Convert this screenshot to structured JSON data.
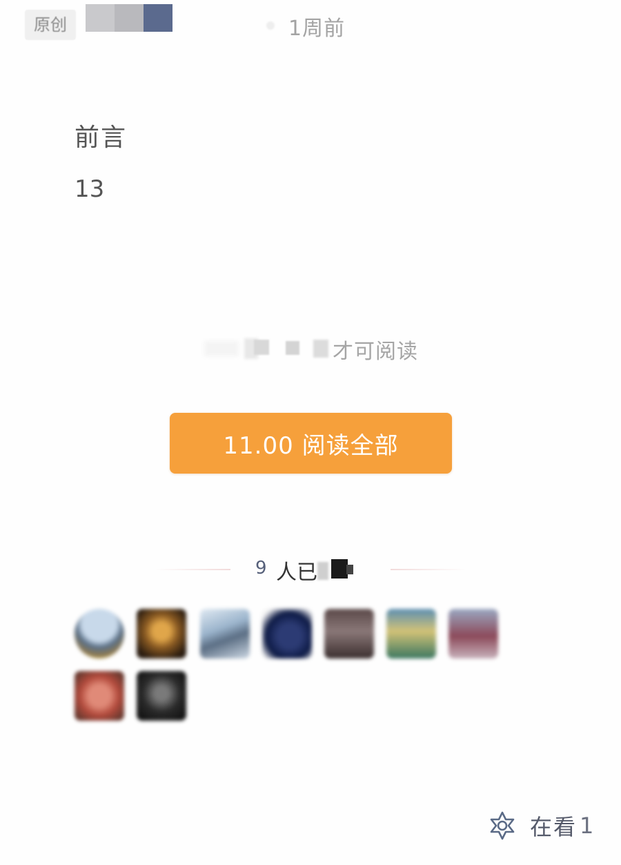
{
  "header": {
    "original_badge": "原创",
    "timestamp": "1周前"
  },
  "article": {
    "section_title": "前言",
    "section_number": "13"
  },
  "paywall": {
    "hint_text": "才可阅读",
    "pay_button_label": "11.00 阅读全部",
    "button_color": "#f6a03b"
  },
  "paid_readers": {
    "count": "9",
    "label": "人已",
    "avatars": [
      {
        "name": "avatar-1"
      },
      {
        "name": "avatar-2"
      },
      {
        "name": "avatar-3"
      },
      {
        "name": "avatar-4"
      },
      {
        "name": "avatar-5"
      },
      {
        "name": "avatar-6"
      },
      {
        "name": "avatar-7"
      },
      {
        "name": "avatar-8"
      },
      {
        "name": "avatar-9"
      }
    ]
  },
  "footer": {
    "watching_label": "在看",
    "watching_count": "1",
    "watching_icon": "star-flower-icon"
  }
}
